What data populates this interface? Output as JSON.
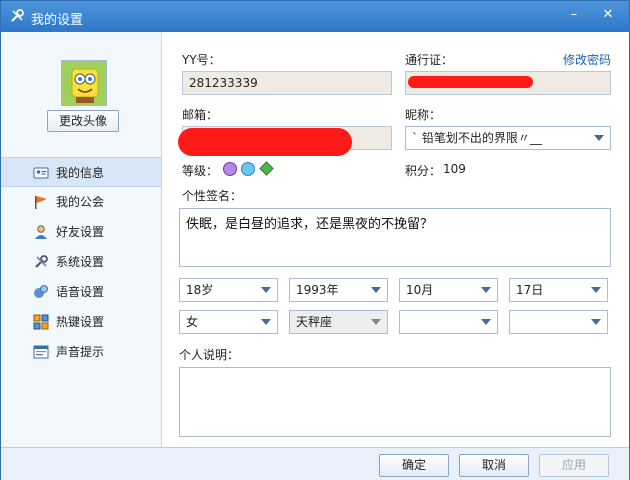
{
  "window": {
    "title": "我的设置",
    "minimize": "–",
    "close": "✕"
  },
  "sidebar": {
    "change_avatar": "更改头像",
    "items": [
      {
        "label": "我的信息",
        "icon": "id-card-icon",
        "active": true
      },
      {
        "label": "我的公会",
        "icon": "flag-icon"
      },
      {
        "label": "好友设置",
        "icon": "user-icon"
      },
      {
        "label": "系统设置",
        "icon": "wrench-icon"
      },
      {
        "label": "语音设置",
        "icon": "voice-icon"
      },
      {
        "label": "热键设置",
        "icon": "keyboard-icon"
      },
      {
        "label": "声音提示",
        "icon": "sound-icon"
      }
    ]
  },
  "form": {
    "yy_label": "YY号：",
    "yy_value": "281233339",
    "passport_label": "通行证：",
    "change_password": "修改密码",
    "email_label": "邮箱：",
    "nickname_label": "昵称：",
    "nickname_value": "ˋ 铅笔划不出的界限〃__",
    "level_label": "等级：",
    "points_label": "积分：",
    "points_value": "109",
    "signature_label": "个性签名：",
    "signature_value": "佚眠，是白昼的追求，还是黑夜的不挽留？",
    "age": "18岁",
    "year": "1993年",
    "month": "10月",
    "day": "17日",
    "gender": "女",
    "zodiac": "天秤座",
    "province": "",
    "city": "",
    "description_label": "个人说明："
  },
  "footer": {
    "ok": "确定",
    "cancel": "取消",
    "apply": "应用"
  },
  "colors": {
    "titlebar": "#2d77c8",
    "redaction": "#ff1a1a",
    "link": "#1a63b3"
  }
}
